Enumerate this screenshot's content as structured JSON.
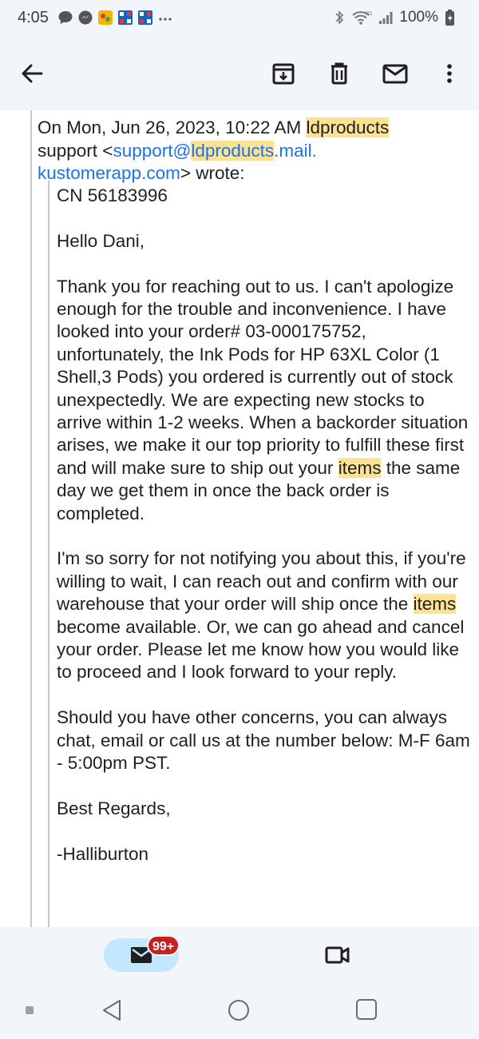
{
  "status_bar": {
    "time": "4:05",
    "battery": "100%",
    "network": "4G"
  },
  "toolbar": {
    "back_icon": "arrow-left-icon",
    "archive_icon": "archive-icon",
    "delete_icon": "trash-icon",
    "mark_unread_icon": "mail-icon",
    "more_icon": "more-vert-icon"
  },
  "email": {
    "attribution": {
      "prefix": "On Mon, Jun 26, 2023, 10:22 AM ",
      "sender_highlight": "ldproducts",
      "sender_rest": "support <",
      "email_start": "support@",
      "email_highlight": "ldproducts",
      "email_end": ".mail.",
      "email_domain": "kustomerapp.com",
      "suffix": "> wrote:"
    },
    "body": {
      "case_number": "CN 56183996",
      "greeting": "Hello Dani,",
      "p1_part1": "Thank you for reaching out to us. I can't apologize enough for the trouble and inconvenience. I have looked into your order# 03-000175752, unfortunately, the Ink Pods for HP 63XL Color (1 Shell,3 Pods) you ordered is currently out of stock unexpectedly. We are expecting new stocks to arrive within 1-2 weeks. When a backorder situation arises, we make it our top priority to fulfill these first and will make sure to ship out your ",
      "p1_highlight": "items",
      "p1_part2": " the same day we get them in once the back order is completed.",
      "p2_part1": "I'm so sorry for not notifying you about this, if you're willing to wait, I can reach out and confirm with our warehouse that your order will ship once the ",
      "p2_highlight": "items",
      "p2_part2": " become available. Or, we can go ahead and cancel your order. Please let me know how you would like to proceed and I look forward to your reply.",
      "p3": "Should you have other concerns, you can always chat, email or call us at the number below: M-F 6am - 5:00pm PST.",
      "closing": "Best Regards,",
      "signature": "-Halliburton"
    }
  },
  "bottom_nav": {
    "mail_badge": "99+",
    "mail_icon": "mail-icon",
    "meet_icon": "video-camera-icon"
  },
  "colors": {
    "highlight": "#fde293",
    "link": "#1a73e8",
    "badge": "#c5221f",
    "pill": "#c2e7ff",
    "bar_bg": "#f2f6fb"
  }
}
